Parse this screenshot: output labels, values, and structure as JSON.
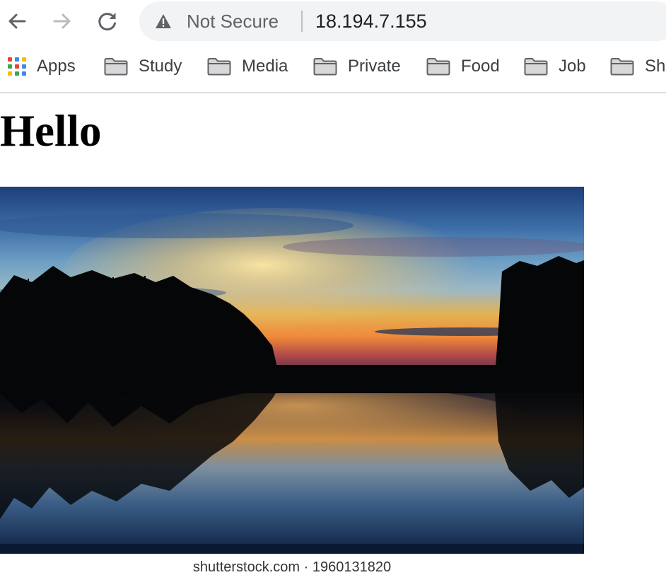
{
  "browser": {
    "security_label": "Not Secure",
    "url": "18.194.7.155"
  },
  "bookmarks": [
    {
      "label": "Apps",
      "icon": "apps-grid-icon"
    },
    {
      "label": "Study",
      "icon": "folder-icon"
    },
    {
      "label": "Media",
      "icon": "folder-icon"
    },
    {
      "label": "Private",
      "icon": "folder-icon"
    },
    {
      "label": "Food",
      "icon": "folder-icon"
    },
    {
      "label": "Job",
      "icon": "folder-icon"
    },
    {
      "label": "Sh",
      "icon": "folder-icon"
    }
  ],
  "page": {
    "heading": "Hello",
    "image_caption": "shutterstock.com · 1960131820"
  },
  "colors": {
    "omnibox_bg": "#f1f3f4",
    "toolbar_icon": "#5f6368",
    "disabled_icon": "#b8bcc0"
  }
}
